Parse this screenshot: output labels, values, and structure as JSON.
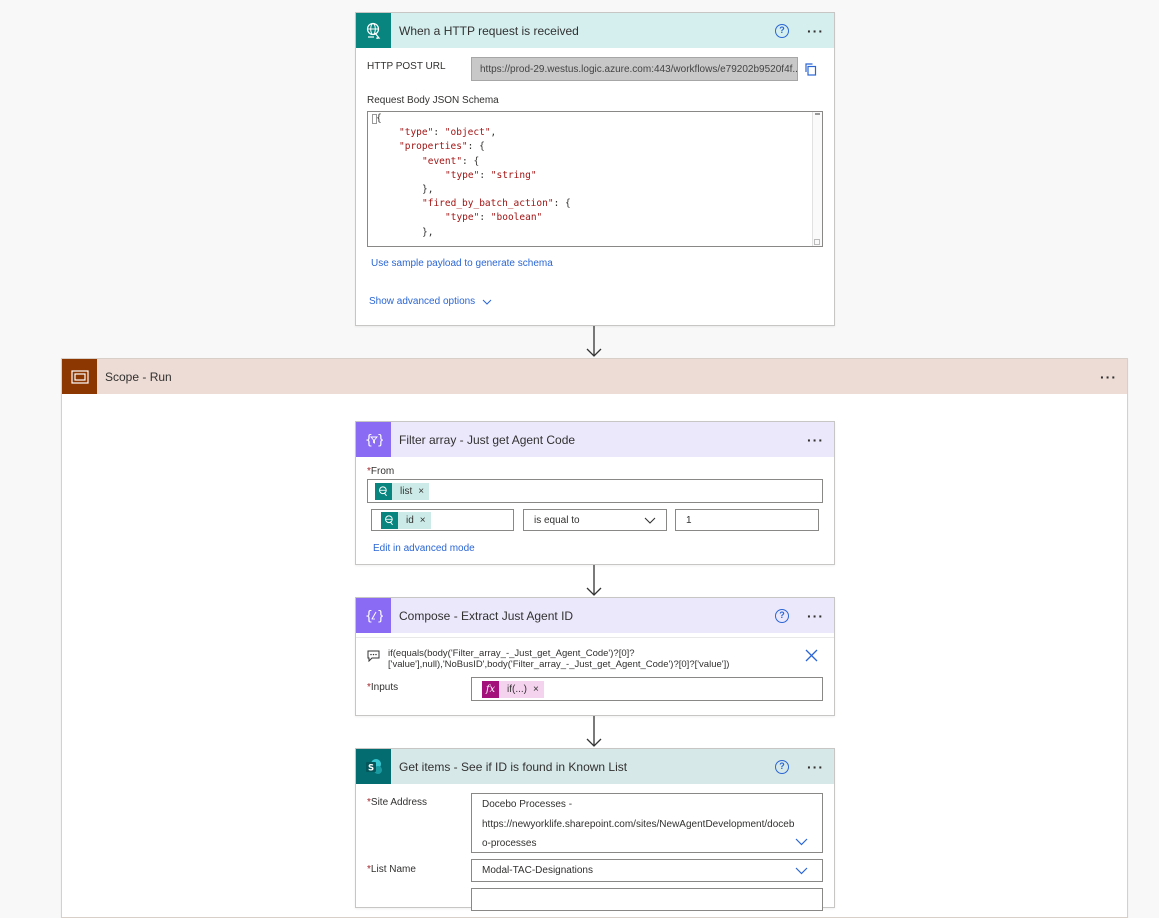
{
  "trigger": {
    "title": "When a HTTP request is received",
    "url_label": "HTTP POST URL",
    "url_value": "https://prod-29.westus.logic.azure.com:443/workflows/e79202b9520f4f...",
    "schema_label": "Request Body JSON Schema",
    "schema_lines": [
      {
        "indent": 0,
        "text": "{"
      },
      {
        "indent": 1,
        "key": "\"type\"",
        "value": "\"object\"",
        "tail": ","
      },
      {
        "indent": 1,
        "key": "\"properties\"",
        "tail": ": {"
      },
      {
        "indent": 2,
        "key": "\"event\"",
        "tail": ": {"
      },
      {
        "indent": 3,
        "key": "\"type\"",
        "value": "\"string\""
      },
      {
        "indent": 2,
        "text": "},"
      },
      {
        "indent": 2,
        "key": "\"fired_by_batch_action\"",
        "tail": ": {"
      },
      {
        "indent": 3,
        "key": "\"type\"",
        "value": "\"boolean\""
      },
      {
        "indent": 2,
        "text": "},"
      }
    ],
    "sample_link": "Use sample payload to generate schema",
    "advanced_link": "Show advanced options"
  },
  "scope": {
    "title": "Scope - Run"
  },
  "filter": {
    "title": "Filter array - Just get Agent Code",
    "from_label": "From",
    "from_token": "list",
    "left_token": "id",
    "operator": "is equal to",
    "right_value": "1",
    "advanced_link": "Edit in advanced mode"
  },
  "compose": {
    "title": "Compose - Extract Just Agent ID",
    "expression_line1": "if(equals(body('Filter_array_-_Just_get_Agent_Code')?[0]?",
    "expression_line2": "['value'],null),'NoBusID',body('Filter_array_-_Just_get_Agent_Code')?[0]?['value'])",
    "inputs_label": "Inputs",
    "inputs_token": "if(...)"
  },
  "getitems": {
    "title": "Get items - See if ID is found in Known List",
    "site_label": "Site Address",
    "site_line1": "Docebo Processes -",
    "site_line2": "https://newyorklife.sharepoint.com/sites/NewAgentDevelopment/doceb",
    "site_line3": "o-processes",
    "list_label": "List Name",
    "list_value": "Modal-TAC-Designations"
  },
  "colors": {
    "http_header": "#d5efef",
    "http_icon": "#08857e",
    "scope_header": "#eddcd5",
    "scope_icon": "#8c3602",
    "filter_header": "#ece8fc",
    "filter_icon": "#8a6bf3",
    "sp_header": "#d7e8e8",
    "sp_icon": "#036c70",
    "link": "#2b66d4"
  }
}
